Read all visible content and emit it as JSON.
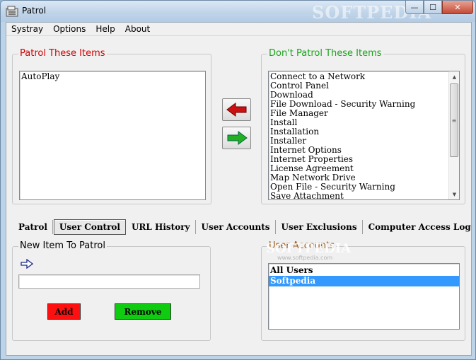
{
  "window": {
    "title": "Patrol",
    "watermark": "SOFTPEDIA",
    "controls": {
      "minimize": "—",
      "maximize": "☐",
      "close": "✕"
    }
  },
  "menu": [
    "Systray",
    "Options",
    "Help",
    "About"
  ],
  "patrol_group": {
    "title": "Patrol These Items",
    "items": [
      "AutoPlay"
    ]
  },
  "dont_patrol_group": {
    "title": "Don't Patrol These Items",
    "items": [
      "Connect to a Network",
      "Control Panel",
      "Download",
      "File Download - Security Warning",
      "File Manager",
      "Install",
      "Installation",
      "Installer",
      "Internet Options",
      "Internet Properties",
      "License Agreement",
      "Map Network Drive",
      "Open File - Security Warning",
      "Save Attachment"
    ]
  },
  "arrows": {
    "move_left_icon": "red-left-arrow-icon",
    "move_right_icon": "green-right-arrow-icon",
    "colors": {
      "left": "#cc1010",
      "right": "#22b022"
    }
  },
  "tabs": [
    {
      "label": "Patrol",
      "active": false
    },
    {
      "label": "User Control",
      "active": true
    },
    {
      "label": "URL History",
      "active": false
    },
    {
      "label": "User Accounts",
      "active": false
    },
    {
      "label": "User Exclusions",
      "active": false
    },
    {
      "label": "Computer Access Log",
      "active": false
    }
  ],
  "new_item_group": {
    "title": "New Item To Patrol",
    "input_value": "",
    "add_label": "Add",
    "remove_label": "Remove",
    "colors": {
      "add": "#ff1010",
      "remove": "#10cc10"
    }
  },
  "user_accounts_group": {
    "title": "User Accounts",
    "items": [
      {
        "label": "All Users",
        "selected": false
      },
      {
        "label": "Softpedia",
        "selected": true
      }
    ],
    "watermark": "SOFTPEDIA",
    "watermark_url": "www.softpedia.com"
  }
}
